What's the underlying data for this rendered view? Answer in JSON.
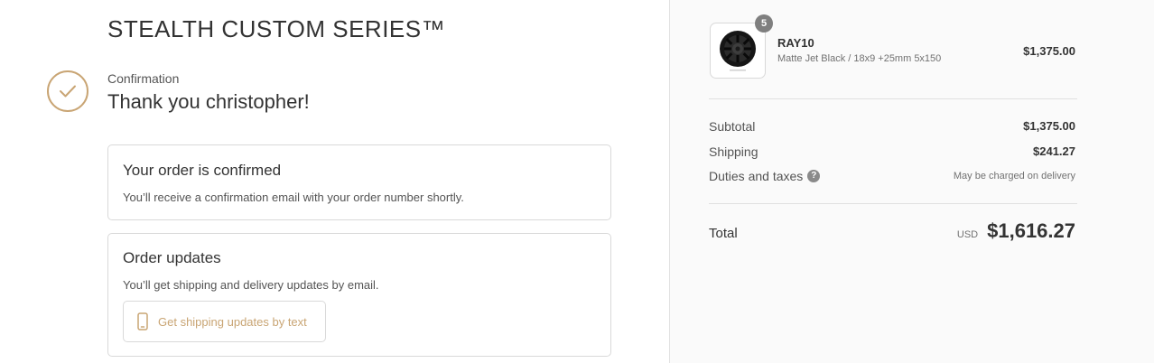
{
  "header": {
    "store_title": "STEALTH CUSTOM SERIES™"
  },
  "confirmation": {
    "label": "Confirmation",
    "greeting": "Thank you christopher!"
  },
  "order_confirmed_card": {
    "title": "Your order is confirmed",
    "text": "You’ll receive a confirmation email with your order number shortly."
  },
  "order_updates_card": {
    "title": "Order updates",
    "text": "You’ll get shipping and delivery updates by email.",
    "sms_button_label": "Get shipping updates by text"
  },
  "summary": {
    "product": {
      "quantity": "5",
      "name": "RAY10",
      "variant": "Matte Jet Black / 18x9 +25mm 5x150",
      "price": "$1,375.00",
      "image_icon": "wheel-icon"
    },
    "subtotal_label": "Subtotal",
    "subtotal_value": "$1,375.00",
    "shipping_label": "Shipping",
    "shipping_value": "$241.27",
    "duties_label": "Duties and taxes",
    "duties_value": "May be charged on delivery",
    "total_label": "Total",
    "currency": "USD",
    "total_value": "$1,616.27"
  },
  "colors": {
    "accent": "#c9a574",
    "sidebar_background": "#fafafa",
    "border": "#d9d9d9"
  }
}
